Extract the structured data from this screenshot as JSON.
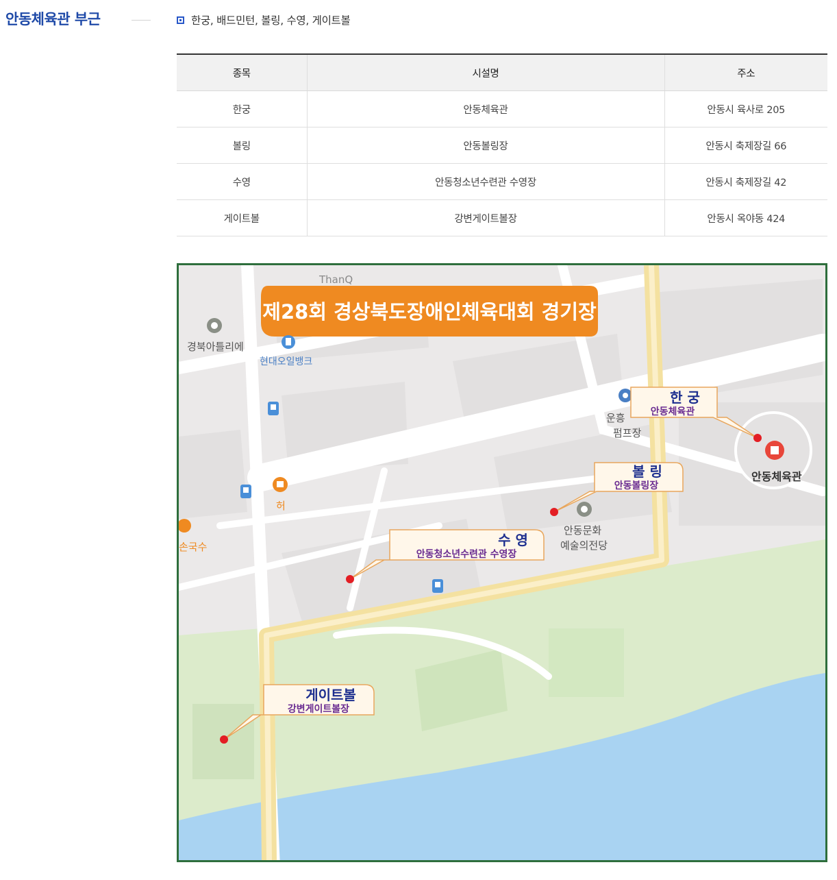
{
  "section": {
    "title": "안동체육관 부근"
  },
  "sports_line": "한궁, 배드민턴, 볼링, 수영, 게이트볼",
  "table": {
    "headers": [
      "종목",
      "시설명",
      "주소"
    ],
    "rows": [
      [
        "한궁",
        "안동체육관",
        "안동시 육사로 205"
      ],
      [
        "볼링",
        "안동볼링장",
        "안동시 축제장길 66"
      ],
      [
        "수영",
        "안동청소년수련관 수영장",
        "안동시 축제장길 42"
      ],
      [
        "게이트볼",
        "강변게이트볼장",
        "안동시 옥야동 424"
      ]
    ]
  },
  "map": {
    "banner": "제28회 경상북도장애인체육대회 경기장",
    "callouts": {
      "hangung": {
        "sport": "한 궁",
        "venue": "안동체육관"
      },
      "bowling": {
        "sport": "볼 링",
        "venue": "안동볼링장"
      },
      "swimming": {
        "sport": "수 영",
        "venue": "안동청소년수련관 수영장"
      },
      "gateball": {
        "sport": "게이트볼",
        "venue": "강변게이트볼장"
      }
    },
    "places": {
      "thanq": "ThanQ",
      "gyeongbuk_atelier": "경북아틀리에",
      "hyundai_oilbank": "현대오일뱅크",
      "unheung_1": "운흥",
      "unheung_2": "펌프장",
      "gym": "안동체육관",
      "arts_center_1": "안동문화",
      "arts_center_2": "예술의전당",
      "heo": "허",
      "songuksu": "손국수"
    },
    "colors": {
      "banner": "#ef8a21",
      "marker": "#e31e24",
      "callout_sport": "#1d2f8f",
      "callout_venue": "#6a2c91",
      "road_main": "#f5e29e",
      "river": "#a9d3f2",
      "park": "#d9ebc8"
    }
  }
}
